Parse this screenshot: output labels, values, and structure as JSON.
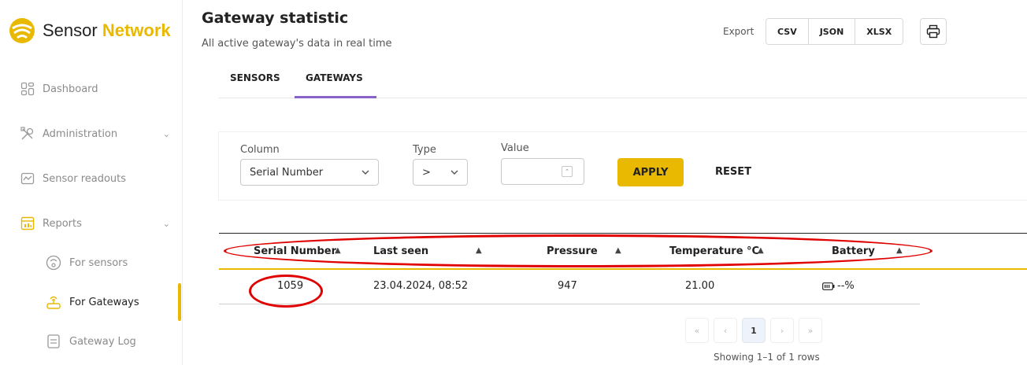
{
  "app": {
    "logo_name": "Sensor",
    "logo_accent": "Network",
    "accent_color": "#e8b900"
  },
  "sidebar": {
    "items": [
      {
        "label": "Dashboard",
        "icon": "dashboard-icon"
      },
      {
        "label": "Administration",
        "icon": "tools-icon",
        "expandable": true
      },
      {
        "label": "Sensor readouts",
        "icon": "chart-icon"
      },
      {
        "label": "Reports",
        "icon": "calendar-icon",
        "expandable": true
      }
    ],
    "sub_items": [
      {
        "label": "For sensors",
        "icon": "sensor-icon"
      },
      {
        "label": "For Gateways",
        "icon": "gateway-icon",
        "active": true
      },
      {
        "label": "Gateway Log",
        "icon": "document-icon"
      }
    ]
  },
  "header": {
    "title": "Gateway statistic",
    "subtitle": "All active gateway's data in real time",
    "export_label": "Export",
    "export_buttons": [
      "CSV",
      "JSON",
      "XLSX"
    ]
  },
  "tabs": [
    {
      "label": "SENSORS"
    },
    {
      "label": "GATEWAYS",
      "active": true
    }
  ],
  "filter": {
    "column_label": "Column",
    "column_value": "Serial Number",
    "type_label": "Type",
    "type_value": ">",
    "value_label": "Value",
    "value": "",
    "apply_label": "APPLY",
    "reset_label": "RESET"
  },
  "table": {
    "columns": [
      {
        "label": "Serial Number",
        "sort": "▲"
      },
      {
        "label": "Last seen",
        "sort": "▲"
      },
      {
        "label": "Pressure",
        "sort": "▲"
      },
      {
        "label": "Temperature °C",
        "sort": "▲"
      },
      {
        "label": "Battery",
        "sort": "▲"
      }
    ],
    "rows": [
      {
        "serial": "1059",
        "last_seen": "23.04.2024, 08:52",
        "pressure": "947",
        "temperature": "21.00",
        "battery": "--%"
      }
    ]
  },
  "pagination": {
    "first": "«",
    "prev": "‹",
    "current": "1",
    "next": "›",
    "last": "»",
    "info": "Showing 1–1 of 1 rows"
  }
}
